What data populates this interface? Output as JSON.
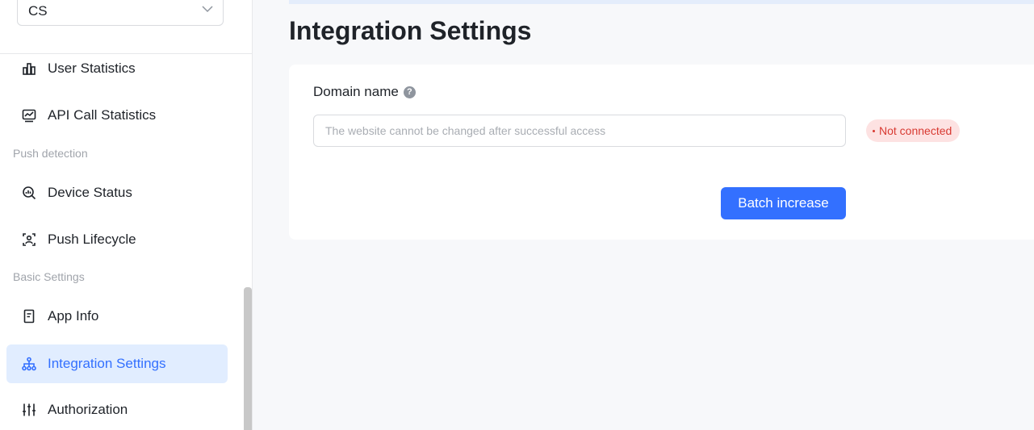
{
  "sidebar": {
    "app_select": {
      "value": "CS"
    },
    "items_top": [
      {
        "label": "User Statistics",
        "icon": "bar-chart-icon"
      },
      {
        "label": "API Call Statistics",
        "icon": "line-chart-icon"
      }
    ],
    "groups": {
      "push_detection": {
        "label": "Push detection",
        "items": [
          {
            "label": "Device Status",
            "icon": "search-chart-icon"
          },
          {
            "label": "Push Lifecycle",
            "icon": "user-card-icon"
          }
        ]
      },
      "basic_settings": {
        "label": "Basic Settings",
        "items": [
          {
            "label": "App Info",
            "icon": "document-icon"
          },
          {
            "label": "Integration Settings",
            "icon": "network-icon",
            "active": true
          },
          {
            "label": "Authorization",
            "icon": "sliders-icon"
          }
        ]
      }
    }
  },
  "main": {
    "title": "Integration Settings",
    "form": {
      "domain_label": "Domain name",
      "help_glyph": "?",
      "domain_placeholder": "The website cannot be changed after successful access",
      "domain_value": "",
      "status": "Not connected",
      "batch_button": "Batch increase"
    }
  },
  "colors": {
    "accent": "#3370ff",
    "active_bg": "#e1edff",
    "status_text": "#d83931",
    "status_bg": "#fde2e2"
  }
}
